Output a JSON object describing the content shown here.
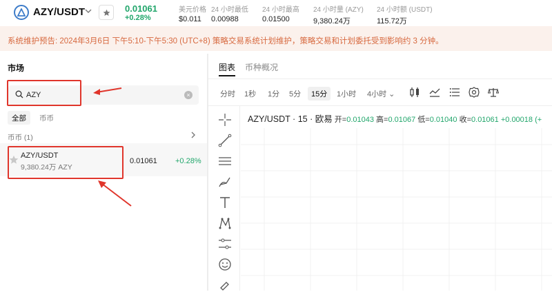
{
  "header": {
    "pair": "AZY/USDT",
    "last_price": "0.01061",
    "change_pct": "+0.28%",
    "stats": [
      {
        "label": "美元价格",
        "value": "$0.011"
      },
      {
        "label": "24 小时最低",
        "value": "0.00988"
      },
      {
        "label": "24 小时最高",
        "value": "0.01500"
      },
      {
        "label": "24 小时量 (AZY)",
        "value": "9,380.24万"
      },
      {
        "label": "24 小时额 (USDT)",
        "value": "115.72万"
      }
    ],
    "icons": {
      "logo": "azy-logo-icon",
      "chevron": "chevron-down-icon",
      "favorite": "star-icon"
    }
  },
  "banner": {
    "text": "系统维护预告: 2024年3月6日 下午5:10-下午5:30 (UTC+8) 策略交易系统计划维护，策略交易和计划委托受到影响约 3 分钟。"
  },
  "market": {
    "title": "市场",
    "search": {
      "value": "AZY",
      "placeholder": ""
    },
    "tabs": [
      "全部",
      "币币"
    ],
    "section": "币币 (1)",
    "rows": [
      {
        "name": "AZY/USDT",
        "volume": "9,380.24万 AZY",
        "price": "0.01061",
        "change": "+0.28%"
      }
    ]
  },
  "chart_panel": {
    "tabs": [
      "图表",
      "币种概况"
    ],
    "intervals": [
      "分时",
      "1秒",
      "1分",
      "5分",
      "15分",
      "1小时",
      "4小时 ⌄"
    ],
    "active_interval": "15分",
    "ohlc": {
      "symbol": "AZY/USDT · 15 · 欧易",
      "open_label": "开=",
      "open": "0.01043",
      "high_label": "高=",
      "high": "0.01067",
      "low_label": "低=",
      "low": "0.01040",
      "close_label": "收=",
      "close": "0.01061",
      "change": "+0.00018 (+"
    },
    "tool_icons": [
      "candlestick-icon",
      "indicator-icon",
      "list-icon",
      "settings-icon",
      "scale-icon"
    ],
    "drawing_tools": [
      "crosshair-icon",
      "trendline-icon",
      "horizontal-lines-icon",
      "brush-icon",
      "text-icon",
      "pattern-icon",
      "measure-icon",
      "emoji-icon",
      "ruler-icon"
    ]
  },
  "colors": {
    "up": "#21a66b",
    "banner_bg": "#fbf1ec",
    "banner_text": "#d7693f",
    "highlight": "#e0352b"
  }
}
